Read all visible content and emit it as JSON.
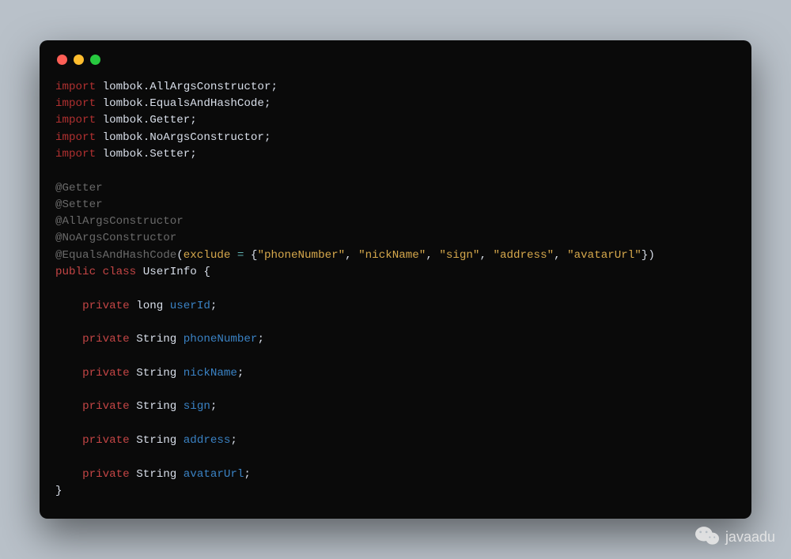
{
  "window": {
    "dots": {
      "red": "#ff5f56",
      "yellow": "#ffbd2e",
      "green": "#27c93f"
    }
  },
  "code": {
    "imports": [
      {
        "kw": "import",
        "target": "lombok.AllArgsConstructor;"
      },
      {
        "kw": "import",
        "target": "lombok.EqualsAndHashCode;"
      },
      {
        "kw": "import",
        "target": "lombok.Getter;"
      },
      {
        "kw": "import",
        "target": "lombok.NoArgsConstructor;"
      },
      {
        "kw": "import",
        "target": "lombok.Setter;"
      }
    ],
    "annotations": {
      "getter": "@Getter",
      "setter": "@Setter",
      "allArgs": "@AllArgsConstructor",
      "noArgs": "@NoArgsConstructor",
      "eqhash": "@EqualsAndHashCode",
      "excludeParam": "exclude",
      "excludeValues": [
        "phoneNumber",
        "nickName",
        "sign",
        "address",
        "avatarUrl"
      ]
    },
    "classDecl": {
      "public": "public",
      "class": "class",
      "name": "UserInfo",
      "open": "{",
      "close": "}"
    },
    "fields": [
      {
        "mod": "private",
        "type": "long",
        "name": "userId"
      },
      {
        "mod": "private",
        "type": "String",
        "name": "phoneNumber"
      },
      {
        "mod": "private",
        "type": "String",
        "name": "nickName"
      },
      {
        "mod": "private",
        "type": "String",
        "name": "sign"
      },
      {
        "mod": "private",
        "type": "String",
        "name": "address"
      },
      {
        "mod": "private",
        "type": "String",
        "name": "avatarUrl"
      }
    ],
    "punct": {
      "lparen": "(",
      "rparen": ")",
      "lbrace": "{",
      "rbrace": "}",
      "eq": " = ",
      "comma": ", ",
      "semi": ";",
      "quote": "\""
    }
  },
  "watermark": {
    "text": "javaadu"
  }
}
